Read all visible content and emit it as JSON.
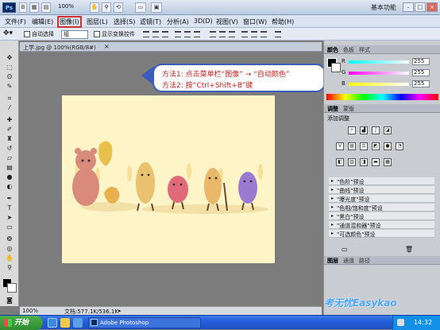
{
  "titlebar": {
    "app_icon": "Ps",
    "zoom": "100%",
    "workspace": "基本功能",
    "window_buttons": {
      "minimize": "–",
      "maximize": "□",
      "close": "×"
    }
  },
  "menubar": {
    "items": [
      "文件(F)",
      "编辑(E)",
      "图像(I)",
      "图层(L)",
      "选择(S)",
      "滤镜(T)",
      "分析(A)",
      "3D(D)",
      "视图(V)",
      "窗口(W)",
      "帮助(H)"
    ]
  },
  "options_bar": {
    "auto_select_label": "自动选择",
    "auto_select_value": "组",
    "show_transform_label": "显示变换控件"
  },
  "document": {
    "tab_title": "上学.jpg @ 100%(RGB/8#)",
    "close_glyph": "×"
  },
  "callout": {
    "line1": "方法1: 点击菜单栏“图像” → “自动颜色”",
    "line2": "方法2: 按“Ctrl+Shift+B”键"
  },
  "statusbar": {
    "zoom": "100%",
    "doc_info": "文档:577.1K/536.1K"
  },
  "panels": {
    "color_tabs": [
      "颜色",
      "色板",
      "样式"
    ],
    "color_sliders": [
      {
        "label": "R",
        "value": "255",
        "color": "#ff4040"
      },
      {
        "label": "G",
        "value": "255",
        "color": "#40ff40"
      },
      {
        "label": "B",
        "value": "255",
        "color": "#4060ff"
      }
    ],
    "adjust_tabs": [
      "调整",
      "蒙版"
    ],
    "adjust_title": "添加调整",
    "presets": [
      "\"色阶\"预设",
      "\"曲线\"预设",
      "\"曝光度\"预设",
      "\"色相/饱和度\"预设",
      "\"黑白\"预设",
      "\"通道混和器\"预设",
      "\"可选颜色\"预设"
    ],
    "layers_tabs": [
      "图层",
      "通道",
      "路径"
    ]
  },
  "taskbar": {
    "start_label": "开始",
    "task_label": "Adobe Photoshop",
    "clock": "14:32"
  },
  "watermark": "考无忧Easykao"
}
